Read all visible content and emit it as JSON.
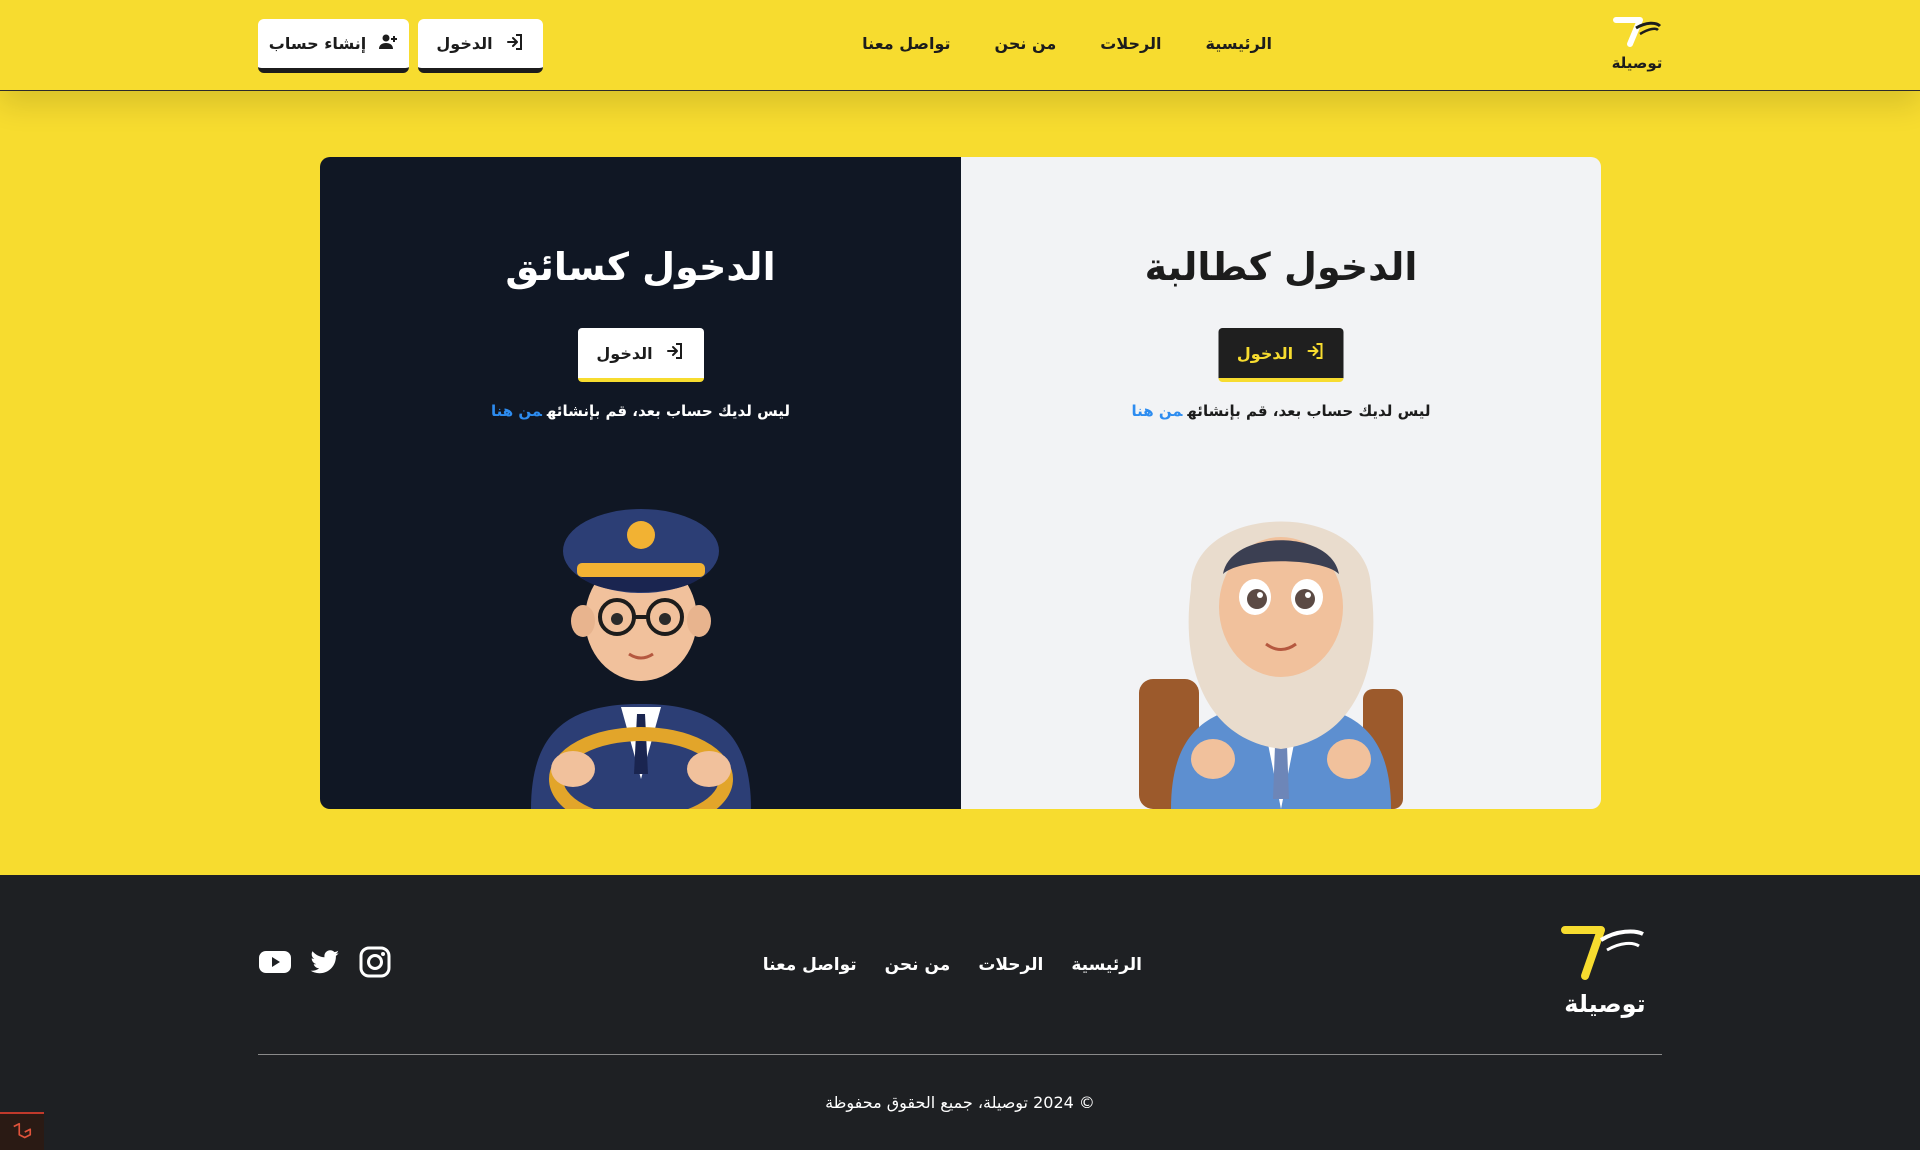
{
  "brand": {
    "logo_text": "توصيلة"
  },
  "nav": {
    "home": "الرئيسية",
    "trips": "الرحلات",
    "about": "من نحن",
    "contact": "تواصل معنا"
  },
  "header_buttons": {
    "login": "الدخول",
    "register": "إنشاء حساب"
  },
  "student_panel": {
    "title": "الدخول كطالبة",
    "button": "الدخول",
    "note": "ليس لديك حساب بعد، قم بإنشائه",
    "note_link": "من هنا"
  },
  "driver_panel": {
    "title": "الدخول كسائق",
    "button": "الدخول",
    "note": "ليس لديك حساب بعد، قم بإنشائه",
    "note_link": "من هنا"
  },
  "footer": {
    "nav": {
      "home": "الرئيسية",
      "trips": "الرحلات",
      "about": "من نحن",
      "contact": "تواصل معنا"
    },
    "social": [
      "youtube-icon",
      "twitter-icon",
      "instagram-icon"
    ],
    "copyright": "© 2024 توصيلة، جميع الحقوق محفوظة"
  },
  "colors": {
    "accent_yellow": "#f7dc2f",
    "dark_navy": "#101724",
    "footer_bg": "#1e2023",
    "link_blue": "#2d8cf0"
  }
}
